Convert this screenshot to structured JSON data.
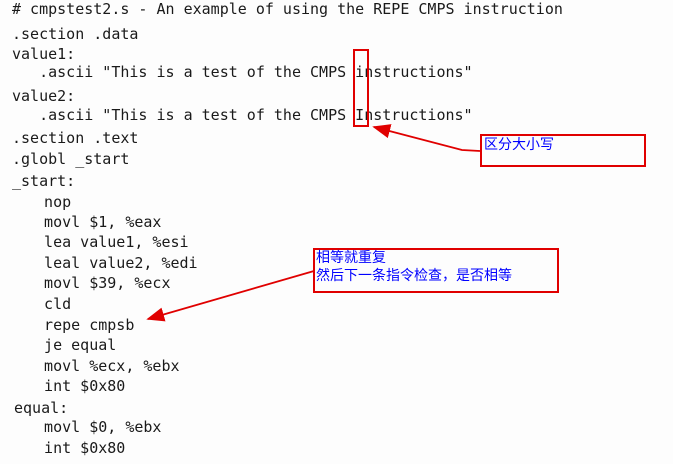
{
  "code_lines": [
    "# cmpstest2.s - An example of using the REPE CMPS instruction",
    ".section .data",
    "value1:",
    "   .ascii \"This is a test of the CMPS instructions\"",
    "value2:",
    "   .ascii \"This is a test of the CMPS Instructions\"",
    ".section .text",
    ".globl _start",
    "_start:",
    "  nop",
    "  movl $1, %eax",
    "  lea value1, %esi",
    "  leal value2, %edi",
    "  movl $39, %ecx",
    "  cld",
    "  repe cmpsb",
    "  je equal",
    "  movl %ecx, %ebx",
    "  int $0x80",
    "equal:",
    "  movl $0, %ebx",
    "  int $0x80"
  ],
  "annotations": {
    "case_note": "区分大小写",
    "repeat_note_line1": "相等就重复",
    "repeat_note_line2": "然后下一条指令检查，是否相等"
  },
  "colors": {
    "annotation_border": "#e00000",
    "annotation_text": "#0000ff",
    "code_text": "#1a1a1a"
  }
}
